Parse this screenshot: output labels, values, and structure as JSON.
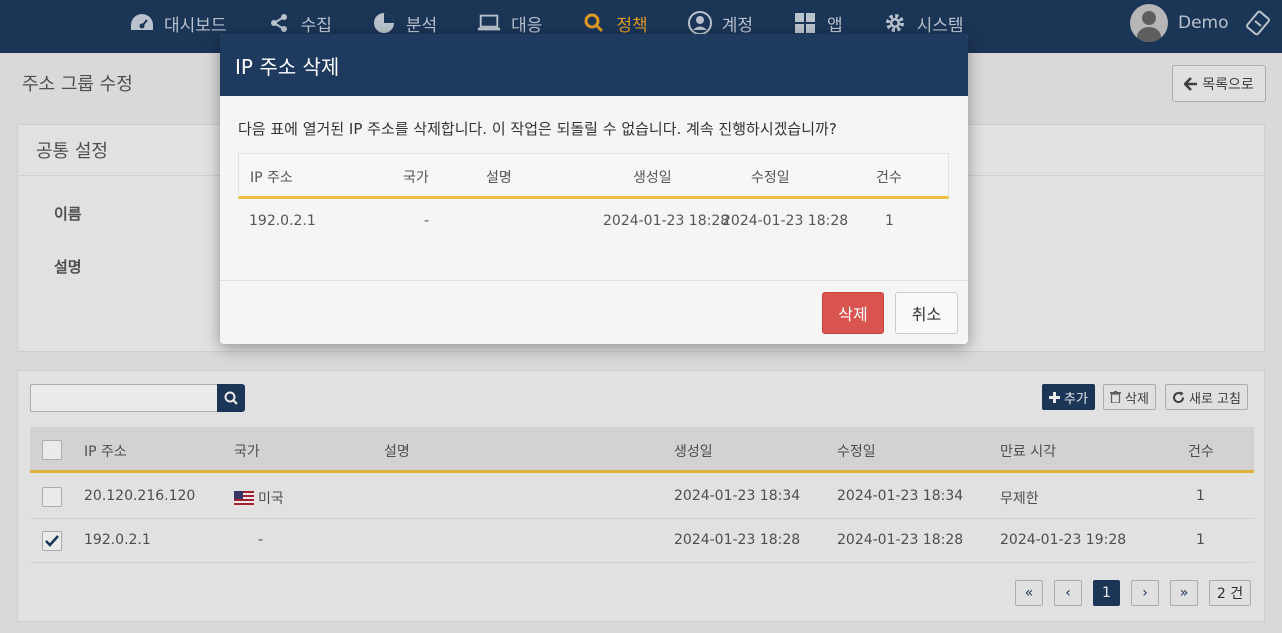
{
  "nav": {
    "items": [
      {
        "label": "대시보드",
        "icon": "dashboard-icon"
      },
      {
        "label": "수집",
        "icon": "share-icon"
      },
      {
        "label": "분석",
        "icon": "pie-chart-icon"
      },
      {
        "label": "대응",
        "icon": "laptop-icon"
      },
      {
        "label": "정책",
        "icon": "search-icon"
      },
      {
        "label": "계정",
        "icon": "user-circle-icon"
      },
      {
        "label": "앱",
        "icon": "apps-grid-icon"
      },
      {
        "label": "시스템",
        "icon": "gear-icon"
      }
    ],
    "active": "정책",
    "user": "Demo",
    "accent_color": "#f0a92a",
    "bg_color": "#1e3a5f"
  },
  "page": {
    "title": "주소 그룹 수정",
    "back_button": "목록으로"
  },
  "common": {
    "title": "공통 설정",
    "name_label": "이름",
    "desc_label": "설명"
  },
  "list": {
    "toolbar": {
      "add": "추가",
      "delete": "삭제",
      "refresh": "새로 고침"
    },
    "columns": {
      "ip": "IP 주소",
      "country": "국가",
      "desc": "설명",
      "created": "생성일",
      "modified": "수정일",
      "expires": "만료 시각",
      "count": "건수"
    },
    "rows": [
      {
        "checked": false,
        "ip": "20.120.216.120",
        "country": "미국",
        "desc": "",
        "created": "2024-01-23 18:34",
        "modified": "2024-01-23 18:34",
        "expires": "무제한",
        "count": "1"
      },
      {
        "checked": true,
        "ip": "192.0.2.1",
        "country": "-",
        "desc": "",
        "created": "2024-01-23 18:28",
        "modified": "2024-01-23 18:28",
        "expires": "2024-01-23 19:28",
        "count": "1"
      }
    ],
    "pager": {
      "current": "1",
      "total": "2 건"
    }
  },
  "modal": {
    "title": "IP 주소 삭제",
    "message": "다음 표에 열거된 IP 주소를 삭제합니다. 이 작업은 되돌릴 수 없습니다. 계속 진행하시겠습니까?",
    "columns": {
      "ip": "IP 주소",
      "country": "국가",
      "desc": "설명",
      "created": "생성일",
      "modified": "수정일",
      "count": "건수"
    },
    "row": {
      "ip": "192.0.2.1",
      "country": "-",
      "desc": "",
      "created": "2024-01-23 18:28",
      "modified": "2024-01-23 18:28",
      "count": "1"
    },
    "delete_button": "삭제",
    "cancel_button": "취소",
    "delete_color": "#d9534f"
  }
}
